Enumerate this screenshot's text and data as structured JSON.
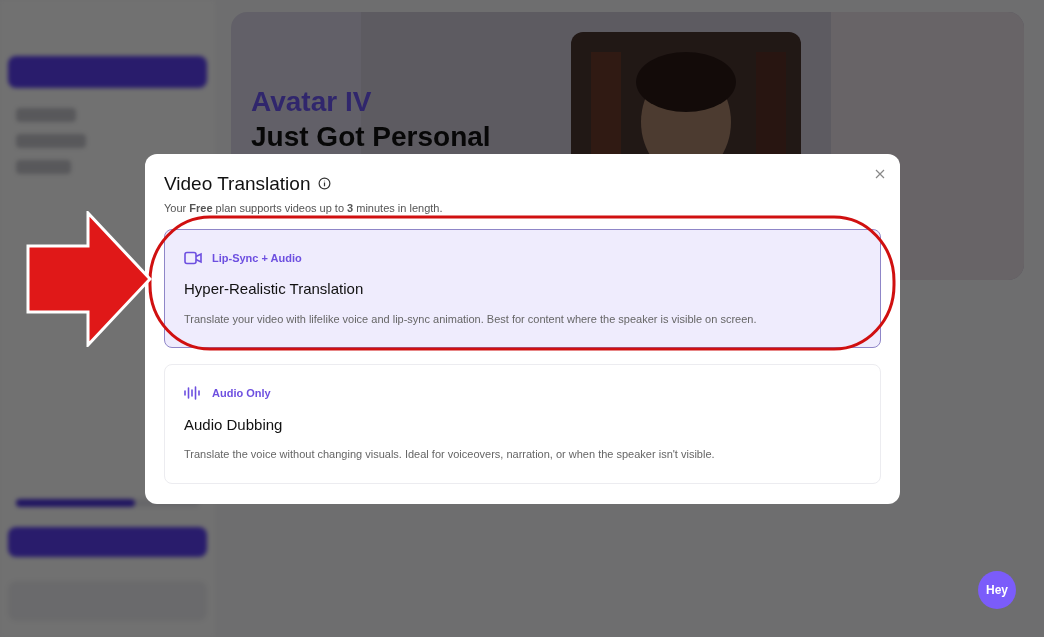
{
  "background": {
    "banner": {
      "accent": "Avatar IV",
      "title": "Just Got Personal"
    },
    "usage": {
      "level": 0.65
    }
  },
  "chat_button": {
    "label": "Hey"
  },
  "dialog": {
    "title": "Video Translation",
    "subtitle": "Your **Free** plan supports videos up to **3** minutes in length.",
    "options": [
      {
        "kind": "video",
        "tag": "Lip-Sync + Audio",
        "title": "Hyper-Realistic Translation",
        "description": "Translate your video with lifelike voice and lip-sync animation. Best for content where the speaker is visible on screen.",
        "selected": true
      },
      {
        "kind": "audio",
        "tag": "Audio Only",
        "title": "Audio Dubbing",
        "description": "Translate the voice without changing visuals. Ideal for voiceovers, narration, or when the speaker isn't visible.",
        "selected": false
      }
    ]
  }
}
